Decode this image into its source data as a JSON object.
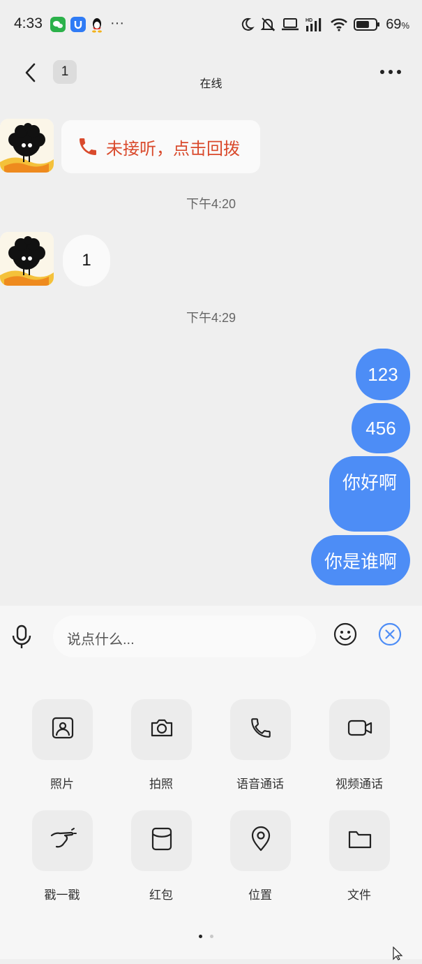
{
  "status_bar": {
    "time": "4:33",
    "overflow": "···",
    "battery_percent": "69",
    "battery_unit": "%",
    "battery_level": 0.69,
    "hd_label": "HD"
  },
  "header": {
    "unread_count": "1",
    "status": "在线"
  },
  "messages": {
    "missed_call": "未接听，点击回拨",
    "time1": "下午4:20",
    "incoming_text": "1",
    "time2": "下午4:29",
    "outgoing": [
      "123",
      "456",
      "你好啊",
      "你是谁啊"
    ]
  },
  "composer": {
    "placeholder": "说点什么..."
  },
  "actions": [
    {
      "label": "照片",
      "icon": "photo-icon"
    },
    {
      "label": "拍照",
      "icon": "camera-icon"
    },
    {
      "label": "语音通话",
      "icon": "phone-icon"
    },
    {
      "label": "视频通话",
      "icon": "video-icon"
    },
    {
      "label": "戳一戳",
      "icon": "poke-icon"
    },
    {
      "label": "红包",
      "icon": "red-packet-icon"
    },
    {
      "label": "位置",
      "icon": "location-icon"
    },
    {
      "label": "文件",
      "icon": "folder-icon"
    }
  ],
  "colors": {
    "accent": "#4d8df6",
    "missed_call": "#d94a2c",
    "background": "#efefef"
  }
}
